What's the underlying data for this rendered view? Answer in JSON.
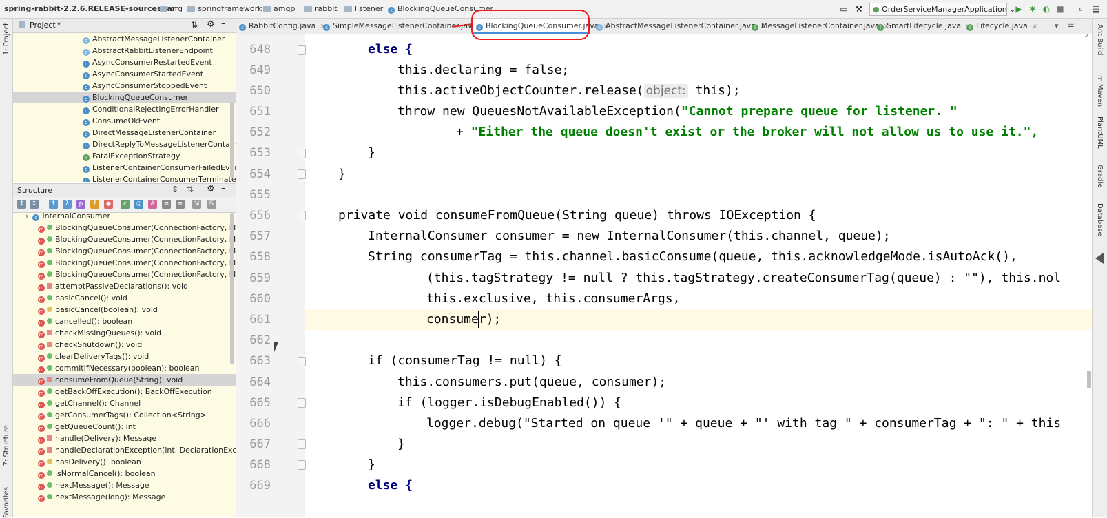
{
  "breadcrumb": [
    "spring-rabbit-2.2.6.RELEASE-sources.jar",
    "org",
    "springframework",
    "amqp",
    "rabbit",
    "listener",
    "BlockingQueueConsumer"
  ],
  "run_config": "OrderServiceManagerApplication",
  "left_stripe": {
    "project": "1: Project",
    "structure": "7: Structure",
    "favorites": "Favorites"
  },
  "right_stripe": [
    "Ant Build",
    "m Maven",
    "PlantUML",
    "Gradle",
    "Database"
  ],
  "project_panel": {
    "title": "Project",
    "items": [
      "AbstractMessageListenerContainer",
      "AbstractRabbitListenerEndpoint",
      "AsyncConsumerRestartedEvent",
      "AsyncConsumerStartedEvent",
      "AsyncConsumerStoppedEvent",
      "BlockingQueueConsumer",
      "ConditionalRejectingErrorHandler",
      "ConsumeOkEvent",
      "DirectMessageListenerContainer",
      "DirectReplyToMessageListenerContainer",
      "FatalExceptionStrategy",
      "ListenerContainerConsumerFailedEvent",
      "ListenerContainerConsumerTerminatedEvent"
    ]
  },
  "structure_panel": {
    "title": "Structure",
    "items": [
      "InternalConsumer",
      "BlockingQueueConsumer(ConnectionFactory, MessagePropertiesConverter)",
      "BlockingQueueConsumer(ConnectionFactory, MessagePropertiesConverter)",
      "BlockingQueueConsumer(ConnectionFactory, MessagePropertiesConverter)",
      "BlockingQueueConsumer(ConnectionFactory, MessagePropertiesConverter)",
      "BlockingQueueConsumer(ConnectionFactory, MessagePropertiesConverter)",
      "attemptPassiveDeclarations(): void",
      "basicCancel(): void",
      "basicCancel(boolean): void",
      "cancelled(): boolean",
      "checkMissingQueues(): void",
      "checkShutdown(): void",
      "clearDeliveryTags(): void",
      "commitIfNecessary(boolean): boolean",
      "consumeFromQueue(String): void",
      "getBackOffExecution(): BackOffExecution",
      "getChannel(): Channel",
      "getConsumerTags(): Collection<String>",
      "getQueueCount(): int",
      "handle(Delivery): Message",
      "handleDeclarationException(int, DeclarationException)",
      "hasDelivery(): boolean",
      "isNormalCancel(): boolean",
      "nextMessage(): Message",
      "nextMessage(long): Message"
    ]
  },
  "tabs": [
    "RabbitConfig.java",
    "SimpleMessageListenerContainer.java",
    "BlockingQueueConsumer.java",
    "AbstractMessageListenerContainer.java",
    "MessageListenerContainer.java",
    "SmartLifecycle.java",
    "Lifecycle.java"
  ],
  "active_tab": "BlockingQueueConsumer.java",
  "line_numbers": [
    "648",
    "649",
    "650",
    "651",
    "652",
    "653",
    "654",
    "655",
    "656",
    "657",
    "658",
    "659",
    "660",
    "661",
    "662",
    "663",
    "664",
    "665",
    "666",
    "667",
    "668",
    "669"
  ],
  "code": {
    "l648": "else {",
    "l649": "this.declaring = false;",
    "l650a": "this.activeObjectCounter.release(",
    "l650hint": "object:",
    "l650b": "this);",
    "l651a": "throw new QueuesNotAvailableException(",
    "l651s": "\"Cannot prepare queue for listener. \"",
    "l652a": "+ ",
    "l652s": "\"Either the queue doesn't exist or the broker will not allow us to use it.\",",
    "l653": "}",
    "l654": "}",
    "l656": "private void consumeFromQueue(String queue) throws IOException {",
    "l657": "InternalConsumer consumer = new InternalConsumer(this.channel, queue);",
    "l658": "String consumerTag = this.channel.basicConsume(queue, this.acknowledgeMode.isAutoAck(),",
    "l659": "(this.tagStrategy != null ? this.tagStrategy.createConsumerTag(queue) : \"\"), this.nol",
    "l660": "this.exclusive, this.consumerArgs,",
    "l661": "consumer);",
    "l663": "if (consumerTag != null) {",
    "l664": "this.consumers.put(queue, consumer);",
    "l665": "if (logger.isDebugEnabled()) {",
    "l666": "logger.debug(\"Started on queue '\" + queue + \"' with tag \" + consumerTag + \": \" + this",
    "l667": "}",
    "l668": "}",
    "l669": "else {"
  },
  "annotation_color": "#ee1c1c"
}
